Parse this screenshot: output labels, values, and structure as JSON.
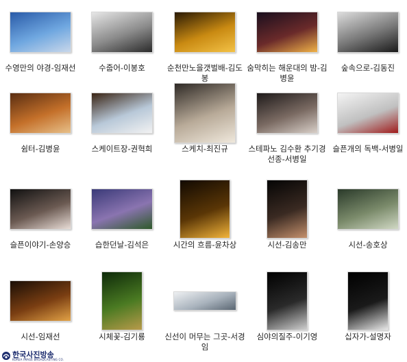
{
  "items": [
    {
      "label": "수영만의 야경-임재선",
      "colors": [
        "#2a5ba8",
        "#6fa7e0",
        "#c9d7ea"
      ],
      "shape": "landscape"
    },
    {
      "label": "수줍어-이봉호",
      "colors": [
        "#e6e6e6",
        "#8a8a8a",
        "#2b2b2b"
      ],
      "shape": "landscape"
    },
    {
      "label": "순천만노을갯벌배-김도봉",
      "colors": [
        "#2a1a05",
        "#c98a12",
        "#f3c247"
      ],
      "shape": "landscape"
    },
    {
      "label": "숨막히는 해운대의 밤-김병윤",
      "colors": [
        "#1a0f1e",
        "#6a2a2a",
        "#f0b248"
      ],
      "shape": "landscape"
    },
    {
      "label": "숲속으로-김동진",
      "colors": [
        "#dcdcdc",
        "#777777",
        "#1a1a1a"
      ],
      "shape": "landscape"
    },
    {
      "label": "쉼터-김병윤",
      "colors": [
        "#5a2e12",
        "#c4702a",
        "#e7c08a"
      ],
      "shape": "landscape"
    },
    {
      "label": "스케이트장-권혁희",
      "colors": [
        "#3a2414",
        "#b8c8d8",
        "#f2f2f2"
      ],
      "shape": "landscape"
    },
    {
      "label": "스케치-최진규",
      "colors": [
        "#2f2a26",
        "#b8aa98",
        "#efe8dc"
      ],
      "shape": "landscape-tall"
    },
    {
      "label": "스테파노 김수환 추기경 선종-서병일",
      "colors": [
        "#1e1a1a",
        "#7a6a62",
        "#d8cfc8"
      ],
      "shape": "landscape"
    },
    {
      "label": "슬픈개의 독백-서병일",
      "colors": [
        "#f4f4f4",
        "#c0c0c0",
        "#a01c1c"
      ],
      "shape": "landscape"
    },
    {
      "label": "슬픈이야기-손양승",
      "colors": [
        "#111111",
        "#6b5a52",
        "#e8dcd6"
      ],
      "shape": "landscape"
    },
    {
      "label": "습한던날-김석은",
      "colors": [
        "#3a3a78",
        "#8a74b0",
        "#2e5a2a"
      ],
      "shape": "landscape"
    },
    {
      "label": "시간의 흐름-윤차상",
      "colors": [
        "#120a02",
        "#5a3606",
        "#f2b43a"
      ],
      "shape": "square"
    },
    {
      "label": "시선-김송만",
      "colors": [
        "#050505",
        "#3a2a22",
        "#c4906c"
      ],
      "shape": "portrait"
    },
    {
      "label": "시선-송호상",
      "colors": [
        "#2a3a2a",
        "#7a8a6a",
        "#d0d8c4"
      ],
      "shape": "landscape"
    },
    {
      "label": "시선-임재선",
      "colors": [
        "#1a0e06",
        "#7a3e12",
        "#e2a246"
      ],
      "shape": "landscape"
    },
    {
      "label": "시체꽃-김기룡",
      "colors": [
        "#0e2a0a",
        "#4a7a22",
        "#b89a4a"
      ],
      "shape": "portrait"
    },
    {
      "label": "신선이 머무는 그곳-서경임",
      "colors": [
        "#eef0f2",
        "#a8b2bc",
        "#5a6672"
      ],
      "shape": "wide"
    },
    {
      "label": "심야의질주-이기영",
      "colors": [
        "#000000",
        "#2a2a2a",
        "#cfcfcf"
      ],
      "shape": "portrait"
    },
    {
      "label": "십자가-설명자",
      "colors": [
        "#000000",
        "#1a1a1a",
        "#e8e8e8"
      ],
      "shape": "portrait"
    }
  ],
  "brand": {
    "name_ko": "한국사진방송",
    "name_en": "KOREA IMAGE BROADCASTING CO.",
    "color": "#1c2c6e"
  }
}
